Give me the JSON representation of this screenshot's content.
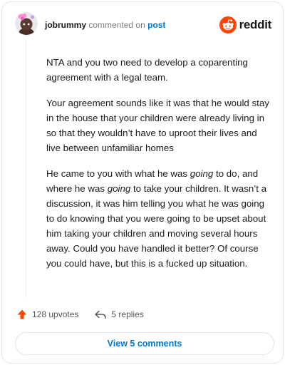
{
  "header": {
    "username": "jobrummy",
    "commented_text": "commented on",
    "post_link": "post",
    "brand": "reddit"
  },
  "comment": {
    "paragraphs": [
      [
        {
          "t": "NTA and you two need to develop a coparenting agreement with a legal team."
        }
      ],
      [
        {
          "t": "Your agreement sounds like it was that he would stay in the house that your children were already living in so that they wouldn’t have to uproot their lives and live between unfamiliar homes"
        }
      ],
      [
        {
          "t": "He came to you with what he was "
        },
        {
          "t": "going",
          "i": true
        },
        {
          "t": " to do, and where he was "
        },
        {
          "t": "going",
          "i": true
        },
        {
          "t": " to take your children. It wasn’t a discussion, it was him telling you what he was going to do knowing that you were going to be upset about him taking your children and moving several hours away. Could you have handled it better? Of course you could have, but this is a fucked up situation."
        }
      ]
    ]
  },
  "actions": {
    "upvotes": "128 upvotes",
    "replies": "5 replies"
  },
  "footer": {
    "view_comments": "View 5 comments"
  },
  "colors": {
    "upvote": "#ff4500",
    "link": "#0079d3",
    "brand": "#ff4500"
  },
  "icons": [
    "avatar-snoo",
    "reddit-logo-icon",
    "upvote-arrow-icon",
    "reply-arrow-icon"
  ]
}
